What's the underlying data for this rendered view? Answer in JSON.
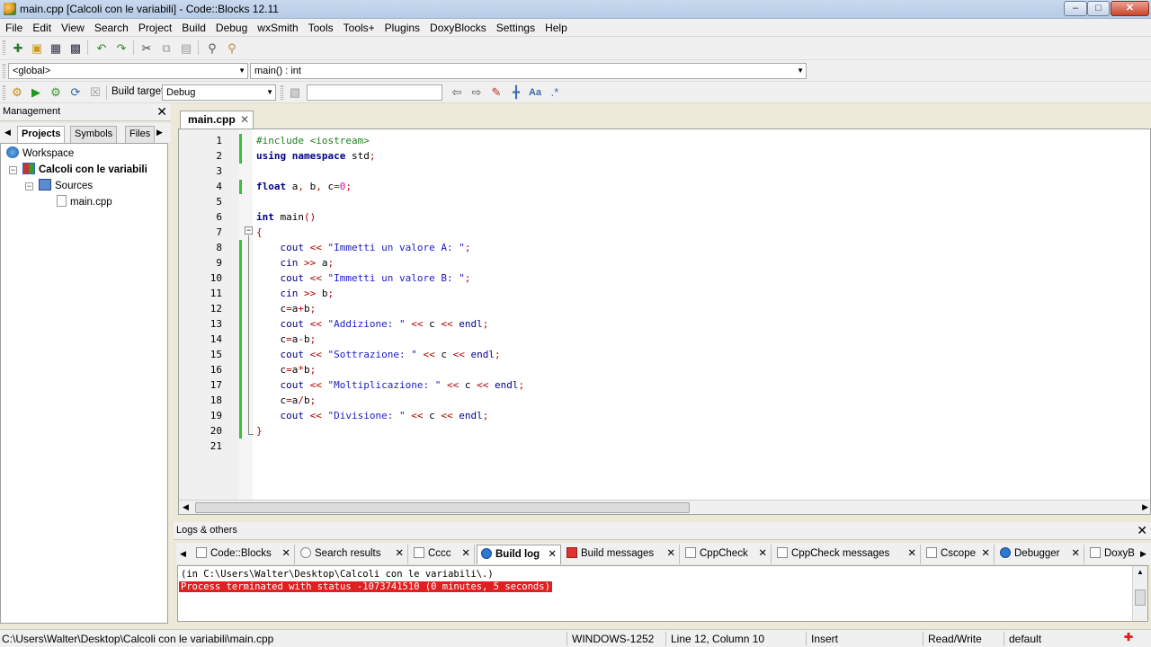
{
  "window": {
    "title": "main.cpp [Calcoli con le variabili] - Code::Blocks 12.11"
  },
  "menu": [
    "File",
    "Edit",
    "View",
    "Search",
    "Project",
    "Build",
    "Debug",
    "wxSmith",
    "Tools",
    "Tools+",
    "Plugins",
    "DoxyBlocks",
    "Settings",
    "Help"
  ],
  "toolbar": {
    "scope_combo": "<global>",
    "function_combo": "main() : int",
    "build_target_label": "Build target:",
    "build_target_value": "Debug"
  },
  "management": {
    "title": "Management",
    "tabs": [
      "Projects",
      "Symbols",
      "Files"
    ],
    "tree": {
      "workspace": "Workspace",
      "project": "Calcoli con le variabili",
      "folder": "Sources",
      "file": "main.cpp"
    }
  },
  "editor": {
    "tab": "main.cpp",
    "line_numbers": [
      "1",
      "2",
      "3",
      "4",
      "5",
      "6",
      "7",
      "8",
      "9",
      "10",
      "11",
      "12",
      "13",
      "14",
      "15",
      "16",
      "17",
      "18",
      "19",
      "20",
      "21"
    ]
  },
  "logs": {
    "title": "Logs & others",
    "tabs": [
      "Code::Blocks",
      "Search results",
      "Cccc",
      "Build log",
      "Build messages",
      "CppCheck",
      "CppCheck messages",
      "Cscope",
      "Debugger",
      "DoxyB"
    ],
    "lines": [
      "(in C:\\Users\\Walter\\Desktop\\Calcoli con le variabili\\.)",
      "Process terminated with status -1073741510 (0 minutes, 5 seconds)"
    ]
  },
  "statusbar": {
    "path": "C:\\Users\\Walter\\Desktop\\Calcoli con le variabili\\main.cpp",
    "encoding": "WINDOWS-1252",
    "position": "Line 12, Column 10",
    "mode": "Insert",
    "access": "Read/Write",
    "profile": "default"
  }
}
